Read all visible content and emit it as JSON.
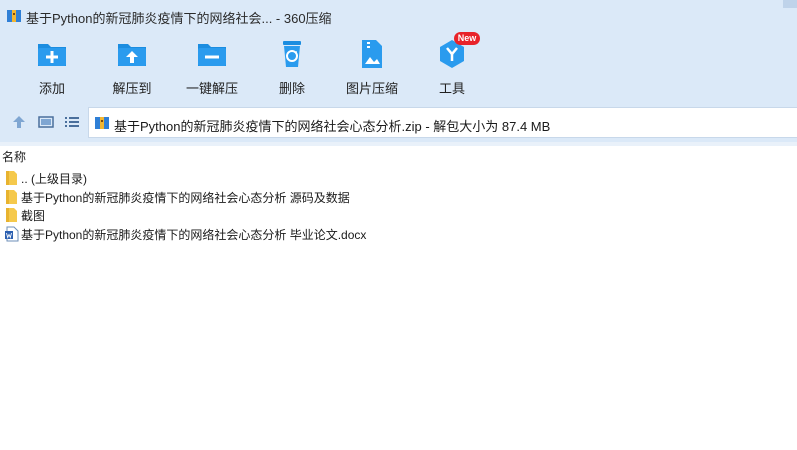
{
  "window": {
    "title": "基于Python的新冠肺炎疫情下的网络社会... - 360压缩"
  },
  "toolbar": {
    "items": [
      {
        "label": "添加",
        "icon": "add-folder-icon"
      },
      {
        "label": "解压到",
        "icon": "extract-to-icon"
      },
      {
        "label": "一键解压",
        "icon": "one-click-extract-icon"
      },
      {
        "label": "删除",
        "icon": "delete-icon"
      },
      {
        "label": "图片压缩",
        "icon": "image-compress-icon"
      },
      {
        "label": "工具",
        "icon": "tools-icon"
      }
    ],
    "tools_badge": "New"
  },
  "address": {
    "path": "基于Python的新冠肺炎疫情下的网络社会心态分析.zip - 解包大小为 87.4 MB"
  },
  "list": {
    "header": "名称",
    "rows": [
      {
        "name": ".. (上级目录)",
        "type": "folder"
      },
      {
        "name": "基于Python的新冠肺炎疫情下的网络社会心态分析 源码及数据",
        "type": "folder"
      },
      {
        "name": "截图",
        "type": "folder"
      },
      {
        "name": "基于Python的新冠肺炎疫情下的网络社会心态分析 毕业论文.docx",
        "type": "docx"
      }
    ]
  },
  "colors": {
    "chrome": "#dbe9f8",
    "accent": "#1b8de0",
    "badge": "#e8232a"
  }
}
